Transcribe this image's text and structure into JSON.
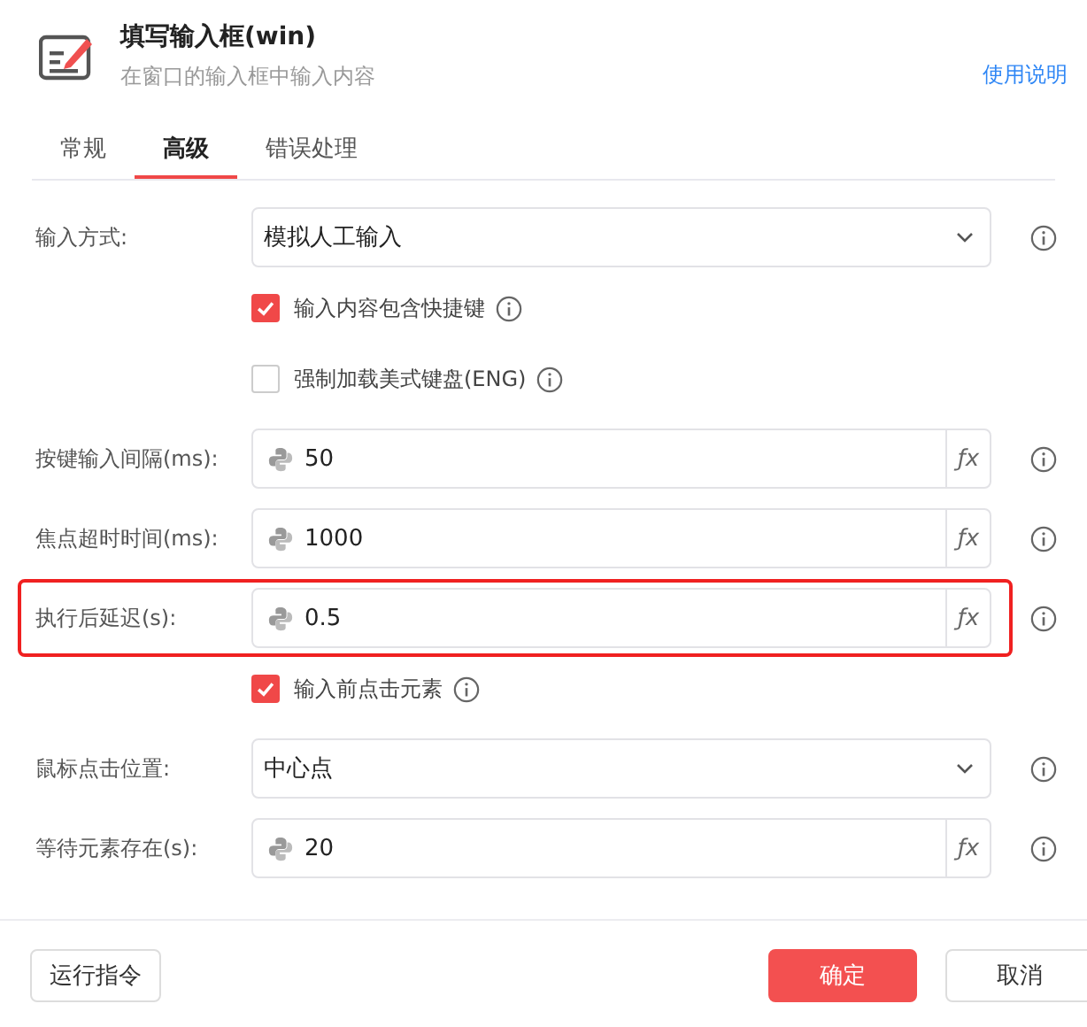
{
  "header": {
    "title": "填写输入框(win)",
    "subtitle": "在窗口的输入框中输入内容",
    "help_link": "使用说明"
  },
  "tabs": [
    {
      "label": "常规",
      "selected": false
    },
    {
      "label": "高级",
      "selected": true
    },
    {
      "label": "错误处理",
      "selected": false
    }
  ],
  "rows": [
    {
      "kind": "select",
      "label": "输入方式:",
      "value": "模拟人工输入",
      "highlighted": false
    },
    {
      "kind": "checkbox",
      "label": "输入内容包含快捷键",
      "checked": true
    },
    {
      "kind": "checkbox",
      "label": "强制加载美式键盘(ENG)",
      "checked": false
    },
    {
      "kind": "input",
      "label": "按键输入间隔(ms):",
      "value": "50",
      "suffix": "ƒx",
      "highlighted": false
    },
    {
      "kind": "input",
      "label": "焦点超时时间(ms):",
      "value": "1000",
      "suffix": "ƒx",
      "highlighted": false
    },
    {
      "kind": "input",
      "label": "执行后延迟(s):",
      "value": "0.5",
      "suffix": "ƒx",
      "highlighted": true
    },
    {
      "kind": "checkbox",
      "label": "输入前点击元素",
      "checked": true
    },
    {
      "kind": "select",
      "label": "鼠标点击位置:",
      "value": "中心点",
      "highlighted": false
    },
    {
      "kind": "input",
      "label": "等待元素存在(s):",
      "value": "20",
      "suffix": "ƒx",
      "highlighted": false
    }
  ],
  "footer": {
    "run_button": "运行指令",
    "ok_button": "确定",
    "cancel_button": "取消"
  }
}
